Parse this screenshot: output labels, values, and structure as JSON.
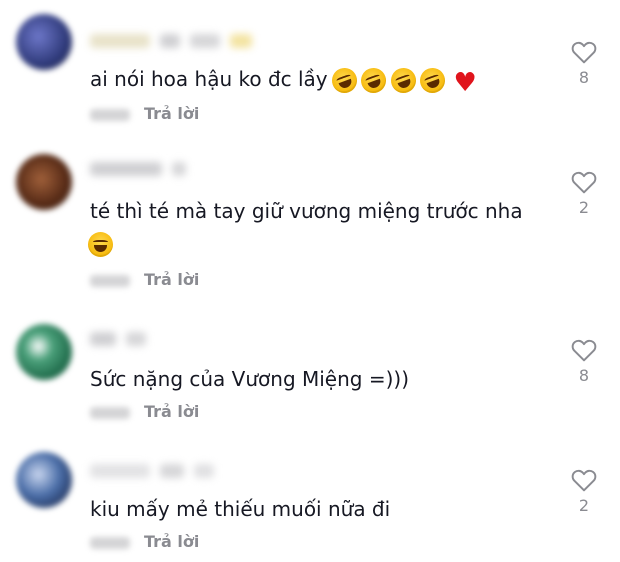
{
  "comments": [
    {
      "text": "ai nói hoa hậu ko đc lầy",
      "emojis": [
        "rolling-laughing",
        "rolling-laughing",
        "rolling-laughing",
        "rolling-laughing",
        "red-heart"
      ],
      "reply_label": "Trả lời",
      "likes": "8",
      "avatar_color": "#2f3a7a"
    },
    {
      "text": "té thì té mà tay giữ vương miệng trước nha",
      "emojis": [
        "grinning-sweat"
      ],
      "reply_label": "Trả lời",
      "likes": "2",
      "avatar_color": "#5a2d18"
    },
    {
      "text": "Sức nặng của Vương Miệng =)))",
      "emojis": [],
      "reply_label": "Trả lời",
      "likes": "8",
      "avatar_color": "#1f6a4a"
    },
    {
      "text": "kiu mấy mẻ thiếu muối nữa đi",
      "emojis": [],
      "reply_label": "Trả lời",
      "likes": "2",
      "avatar_color": "#4b6ea8"
    }
  ],
  "colors": {
    "text": "#161823",
    "muted": "#8a8b91",
    "heart": "#e0141c"
  },
  "icons": {
    "like": "heart-outline-icon"
  }
}
